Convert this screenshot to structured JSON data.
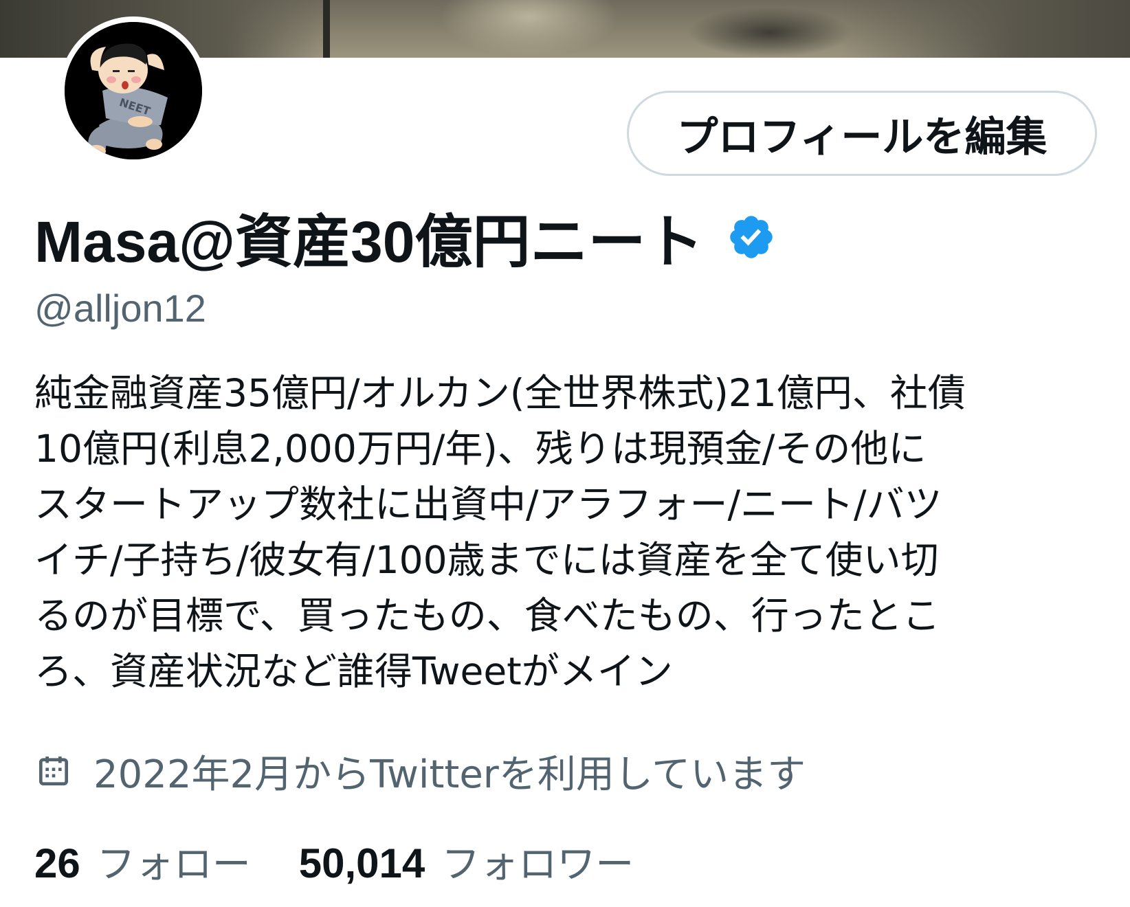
{
  "profile": {
    "edit_button_label": "プロフィールを編集",
    "display_name": "Masa@資産30億円ニート",
    "handle": "@alljon12",
    "bio_lines": [
      "純金融資産35億円/オルカン(全世界株式)21億円、社債",
      "10億円(利息2,000万円/年)、残りは現預金/その他に",
      "スタートアップ数社に出資中/アラフォー/ニート/バツ",
      "イチ/子持ち/彼女有/100歳までには資産を全て使い切",
      "るのが目標で、買ったもの、食べたもの、行ったとこ",
      "ろ、資産状況など誰得Tweetがメイン"
    ],
    "joined_text": "2022年2月からTwitterを利用しています",
    "following_count": "26",
    "following_label": "フォロー",
    "followers_count": "50,014",
    "followers_label": "フォロワー"
  },
  "icons": {
    "verified": "verified-badge-icon",
    "calendar": "calendar-icon"
  },
  "colors": {
    "text_primary": "#0f1419",
    "text_secondary": "#536471",
    "verified_blue": "#1d9bf0",
    "button_border": "#cfd9de"
  }
}
